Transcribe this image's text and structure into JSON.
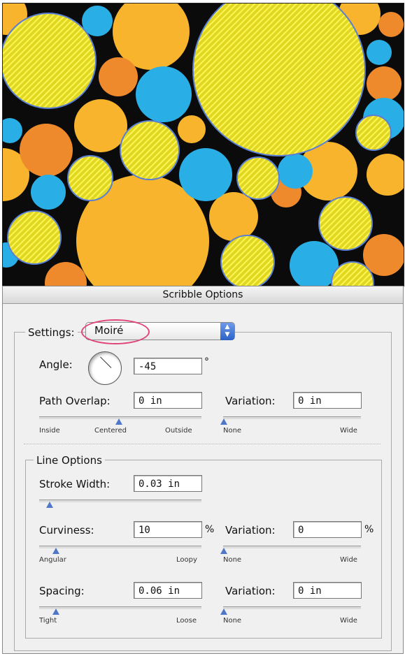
{
  "dialog": {
    "title": "Scribble Options",
    "settings_label": "Settings:",
    "settings_value": "Moiré",
    "angle_label": "Angle:",
    "angle_value": "-45",
    "angle_unit": "°",
    "path_overlap_label": "Path Overlap:",
    "path_overlap_value": "0 in",
    "path_variation_label": "Variation:",
    "path_variation_value": "0 in",
    "overlap_slider": {
      "left": "Inside",
      "center": "Centered",
      "right": "Outside"
    },
    "overlap_variation_slider": {
      "left": "None",
      "right": "Wide"
    },
    "line_options": {
      "legend": "Line Options",
      "stroke_width_label": "Stroke Width:",
      "stroke_width_value": "0.03 in",
      "curviness_label": "Curviness:",
      "curviness_value": "10",
      "curviness_unit": "%",
      "curviness_variation_label": "Variation:",
      "curviness_variation_value": "0",
      "curviness_variation_unit": "%",
      "curviness_slider": {
        "left": "Angular",
        "right": "Loopy"
      },
      "curviness_variation_slider": {
        "left": "None",
        "right": "Wide"
      },
      "spacing_label": "Spacing:",
      "spacing_value": "0.06 in",
      "spacing_variation_label": "Variation:",
      "spacing_variation_value": "0 in",
      "spacing_slider": {
        "left": "Tight",
        "right": "Loose"
      },
      "spacing_variation_slider": {
        "left": "None",
        "right": "Wide"
      }
    }
  },
  "colors": {
    "orange": "#f7b42c",
    "dark_orange": "#ef8a2c",
    "blue": "#2aaee6",
    "scribble_yellow": "#f5ea2e",
    "highlight_pink": "#e0457b",
    "handle_blue": "#5a7fd4"
  }
}
